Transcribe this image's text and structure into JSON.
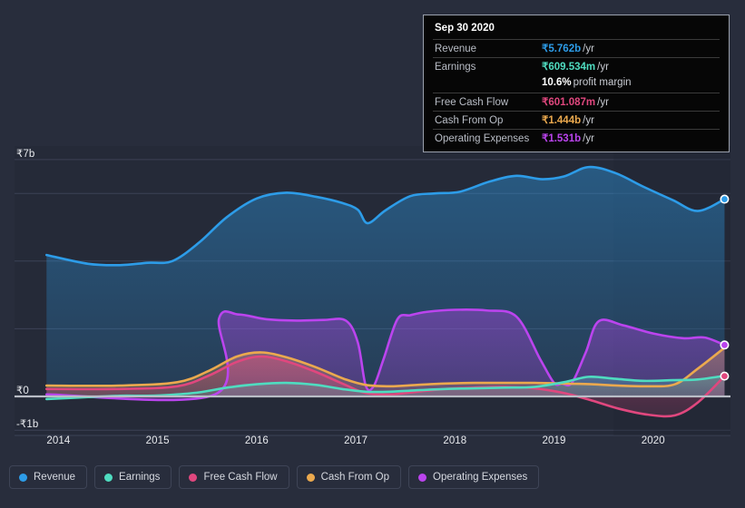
{
  "tooltip": {
    "date": "Sep 30 2020",
    "rows": [
      {
        "label": "Revenue",
        "value": "₹5.762b",
        "unit": "/yr",
        "color": "#2d9ce8",
        "sub": null
      },
      {
        "label": "Earnings",
        "value": "₹609.534m",
        "unit": "/yr",
        "color": "#4fdcc0",
        "sub": "10.6%",
        "sub_unit": "profit margin"
      },
      {
        "label": "Free Cash Flow",
        "value": "₹601.087m",
        "unit": "/yr",
        "color": "#e0477e",
        "sub": null
      },
      {
        "label": "Cash From Op",
        "value": "₹1.444b",
        "unit": "/yr",
        "color": "#eba94e",
        "sub": null
      },
      {
        "label": "Operating Expenses",
        "value": "₹1.531b",
        "unit": "/yr",
        "color": "#bb44ee",
        "sub": null
      }
    ]
  },
  "legend": [
    {
      "label": "Revenue",
      "color": "#2d9ce8"
    },
    {
      "label": "Earnings",
      "color": "#4fdcc0"
    },
    {
      "label": "Free Cash Flow",
      "color": "#e0477e"
    },
    {
      "label": "Cash From Op",
      "color": "#eba94e"
    },
    {
      "label": "Operating Expenses",
      "color": "#bb44ee"
    }
  ],
  "axes": {
    "y_ticks": [
      {
        "label": "₹7b",
        "value": 7
      },
      {
        "label": "₹0",
        "value": 0
      },
      {
        "label": "-₹1b",
        "value": -1
      }
    ],
    "x_ticks": [
      "2014",
      "2015",
      "2016",
      "2017",
      "2018",
      "2019",
      "2020"
    ]
  },
  "chart_data": {
    "type": "area",
    "title": "",
    "xlabel": "",
    "ylabel": "",
    "currency": "INR",
    "ylim": [
      -1.4,
      7.4
    ],
    "xlim": [
      2013.85,
      2020.78
    ],
    "grid": true,
    "legend_position": "bottom",
    "y_gridline_values": [
      7,
      6,
      4,
      2,
      0,
      -1
    ],
    "zero_line_value": 0,
    "forecast_boundary_x": 2019.6,
    "series": [
      {
        "name": "Revenue",
        "color": "#2d9ce8",
        "x": [
          2013.88,
          2014.3,
          2014.62,
          2014.9,
          2015.15,
          2015.42,
          2015.7,
          2016.0,
          2016.3,
          2016.6,
          2016.86,
          2017.02,
          2017.12,
          2017.3,
          2017.55,
          2017.8,
          2018.05,
          2018.35,
          2018.62,
          2018.88,
          2019.1,
          2019.35,
          2019.62,
          2019.9,
          2020.2,
          2020.45,
          2020.72
        ],
        "y": [
          4.18,
          3.92,
          3.88,
          3.95,
          4.0,
          4.55,
          5.3,
          5.85,
          6.02,
          5.9,
          5.72,
          5.52,
          5.12,
          5.5,
          5.92,
          6.0,
          6.05,
          6.35,
          6.52,
          6.42,
          6.5,
          6.78,
          6.6,
          6.2,
          5.8,
          5.48,
          5.83
        ]
      },
      {
        "name": "Earnings",
        "color": "#4fdcc0",
        "x": [
          2013.88,
          2014.3,
          2014.62,
          2014.9,
          2015.15,
          2015.42,
          2015.7,
          2016.0,
          2016.3,
          2016.6,
          2016.86,
          2017.1,
          2017.35,
          2017.6,
          2017.9,
          2018.2,
          2018.5,
          2018.8,
          2019.1,
          2019.35,
          2019.62,
          2019.9,
          2020.2,
          2020.45,
          2020.72
        ],
        "y": [
          -0.08,
          -0.02,
          0.02,
          0.02,
          0.05,
          0.12,
          0.26,
          0.36,
          0.4,
          0.34,
          0.22,
          0.14,
          0.14,
          0.18,
          0.22,
          0.24,
          0.26,
          0.28,
          0.42,
          0.58,
          0.52,
          0.46,
          0.48,
          0.5,
          0.61
        ]
      },
      {
        "name": "Free Cash Flow",
        "color": "#e0477e",
        "x": [
          2013.88,
          2014.62,
          2015.2,
          2015.52,
          2015.8,
          2016.05,
          2016.32,
          2016.6,
          2016.88,
          2017.1,
          2017.35,
          2017.62,
          2017.9,
          2018.2,
          2018.5,
          2018.8,
          2019.1,
          2019.38,
          2019.65,
          2019.95,
          2020.22,
          2020.45,
          2020.72
        ],
        "y": [
          0.22,
          0.22,
          0.3,
          0.62,
          1.02,
          1.18,
          1.02,
          0.72,
          0.36,
          0.1,
          0.06,
          0.14,
          0.22,
          0.26,
          0.28,
          0.24,
          0.1,
          -0.12,
          -0.36,
          -0.54,
          -0.56,
          -0.18,
          0.6
        ]
      },
      {
        "name": "Cash From Op",
        "color": "#eba94e",
        "x": [
          2013.88,
          2014.62,
          2015.2,
          2015.52,
          2015.8,
          2016.05,
          2016.32,
          2016.6,
          2016.88,
          2017.1,
          2017.35,
          2017.62,
          2017.9,
          2018.2,
          2018.5,
          2018.8,
          2019.1,
          2019.38,
          2019.65,
          2019.95,
          2020.22,
          2020.45,
          2020.72
        ],
        "y": [
          0.32,
          0.32,
          0.42,
          0.76,
          1.18,
          1.3,
          1.14,
          0.86,
          0.52,
          0.34,
          0.3,
          0.34,
          0.38,
          0.4,
          0.4,
          0.4,
          0.38,
          0.36,
          0.32,
          0.3,
          0.36,
          0.82,
          1.44
        ]
      },
      {
        "name": "Operating Expenses",
        "color": "#bb44ee",
        "x": [
          2013.88,
          2015.58,
          2015.62,
          2015.82,
          2016.1,
          2016.4,
          2016.68,
          2016.9,
          2017.02,
          2017.1,
          2017.18,
          2017.28,
          2017.42,
          2017.55,
          2017.72,
          2018.0,
          2018.32,
          2018.62,
          2018.86,
          2019.0,
          2019.08,
          2019.18,
          2019.32,
          2019.45,
          2019.7,
          2020.0,
          2020.3,
          2020.52,
          2020.72
        ],
        "y": [
          0.06,
          0.06,
          2.3,
          2.42,
          2.28,
          2.24,
          2.26,
          2.24,
          1.6,
          0.32,
          0.3,
          1.1,
          2.28,
          2.4,
          2.5,
          2.56,
          2.54,
          2.36,
          1.1,
          0.4,
          0.38,
          0.4,
          1.3,
          2.22,
          2.1,
          1.86,
          1.72,
          1.74,
          1.52
        ]
      }
    ],
    "endpoint_markers": [
      {
        "series": "Revenue",
        "x": 2020.72,
        "y": 5.83
      },
      {
        "series": "Operating Expenses",
        "x": 2020.72,
        "y": 1.52
      },
      {
        "series": "Free Cash Flow",
        "x": 2020.72,
        "y": 0.6
      }
    ]
  }
}
